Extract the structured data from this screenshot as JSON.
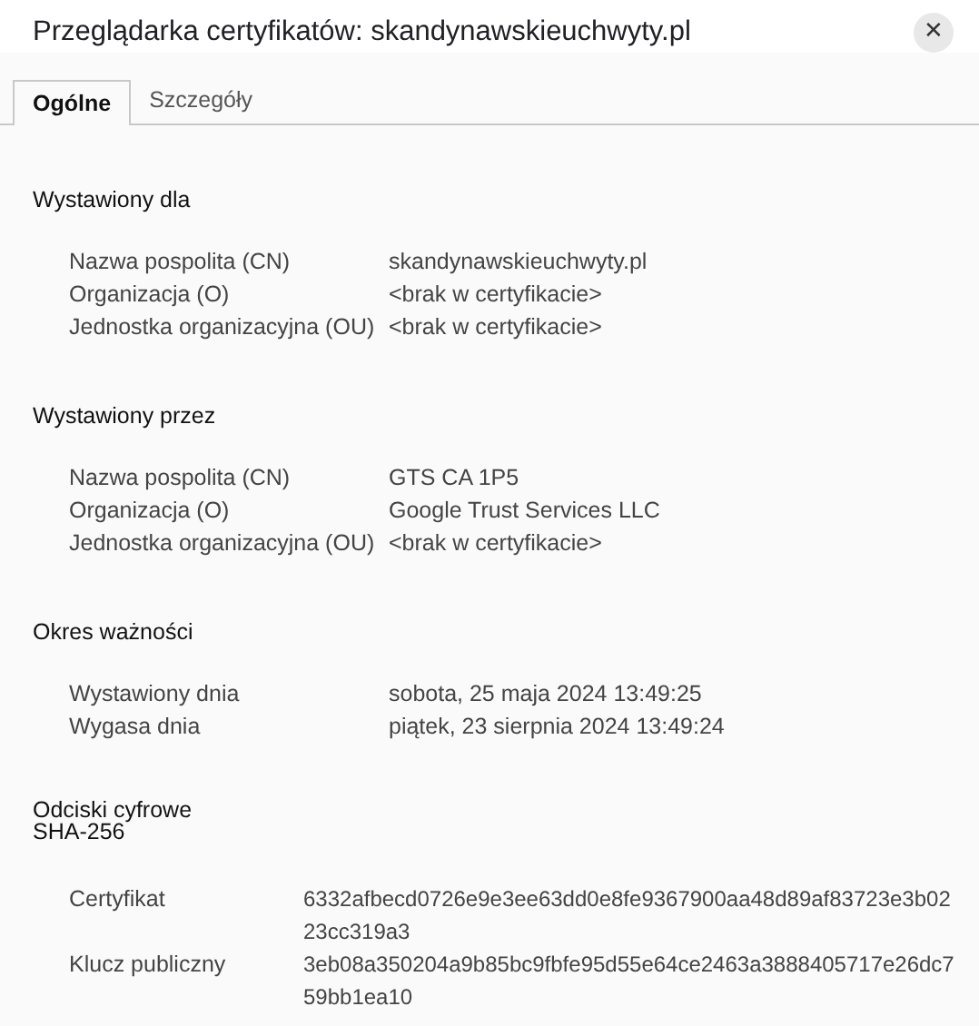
{
  "window": {
    "title": "Przeglądarka certyfikatów: skandynawskieuchwyty.pl",
    "close": "✕"
  },
  "tabs": [
    {
      "label": "Ogólne",
      "selected": true
    },
    {
      "label": "Szczegóły",
      "selected": false
    }
  ],
  "sections": [
    {
      "kind": "fields",
      "title": "Wystawiony dla",
      "rows": [
        {
          "label": "Nazwa pospolita (CN)",
          "value": "skandynawskieuchwyty.pl"
        },
        {
          "label": "Organizacja (O)",
          "value": "<brak w certyfikacie>"
        },
        {
          "label": "Jednostka organizacyjna (OU)",
          "value": "<brak w certyfikacie>"
        }
      ]
    },
    {
      "kind": "fields",
      "title": "Wystawiony przez",
      "rows": [
        {
          "label": "Nazwa pospolita (CN)",
          "value": "GTS CA 1P5"
        },
        {
          "label": "Organizacja (O)",
          "value": "Google Trust Services LLC"
        },
        {
          "label": "Jednostka organizacyjna (OU)",
          "value": "<brak w certyfikacie>"
        }
      ]
    },
    {
      "kind": "fields",
      "title": "Okres ważności",
      "rows": [
        {
          "label": "Wystawiony dnia",
          "value": "sobota, 25 maja 2024 13:49:25"
        },
        {
          "label": "Wygasa dnia",
          "value": "piątek, 23 sierpnia 2024 13:49:24"
        }
      ]
    },
    {
      "kind": "hashes",
      "title": "Odciski cyfrowe SHA-256",
      "rows": [
        {
          "label": "Certyfikat",
          "value": "6332afbecd0726e9e3ee63dd0e8fe9367900aa48d89af83723e3b0223cc319a3"
        },
        {
          "label": "Klucz publiczny",
          "value": "3eb08a350204a9b85bc9fbfe95d55e64ce2463a3888405717e26dc759bb1ea10"
        }
      ]
    }
  ]
}
